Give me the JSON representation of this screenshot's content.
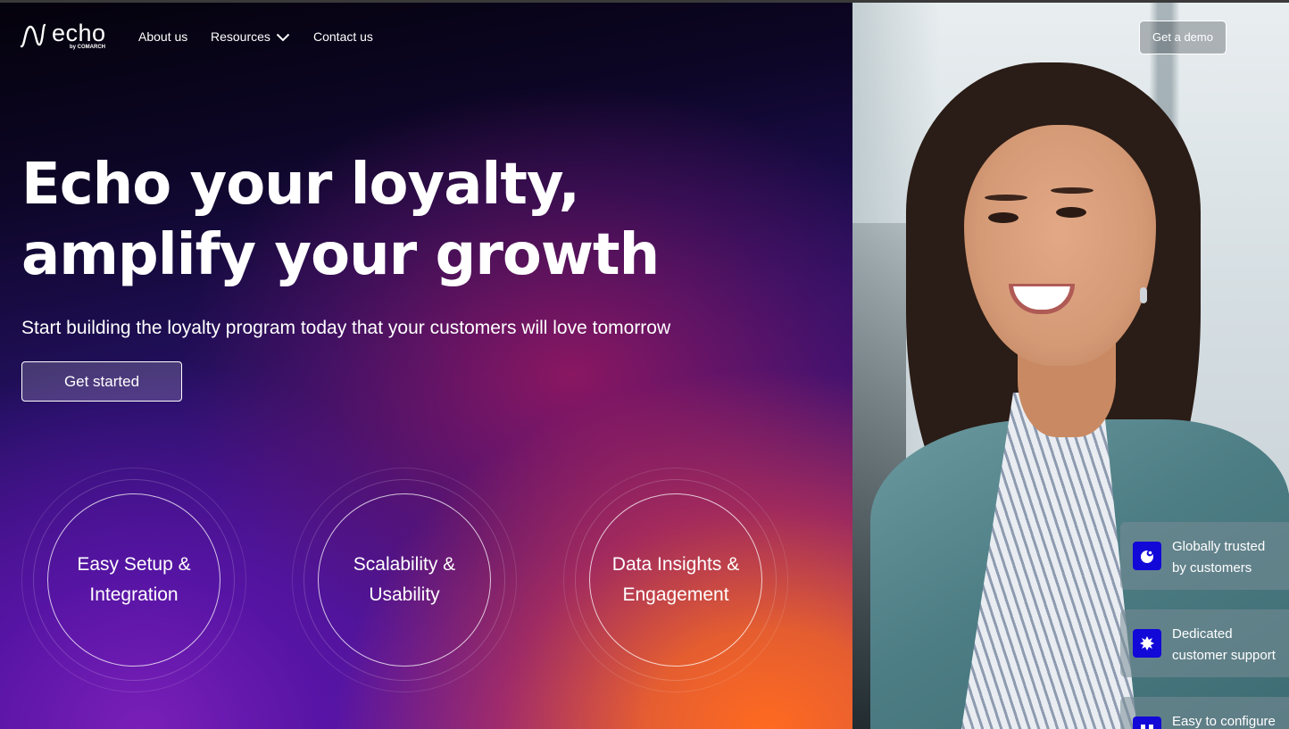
{
  "brand": {
    "name": "echo",
    "tagline": "by COMARCH"
  },
  "nav": {
    "about": "About us",
    "resources": "Resources",
    "contact": "Contact us",
    "demo": "Get a demo"
  },
  "hero": {
    "headline_line1": "Echo your loyalty,",
    "headline_line2": "amplify your growth",
    "subheadline": "Start building the loyalty program today that your customers will love tomorrow",
    "cta": "Get started"
  },
  "features": [
    {
      "line1": "Easy Setup &",
      "line2": "Integration"
    },
    {
      "line1": "Scalability &",
      "line2": "Usability"
    },
    {
      "line1": "Data Insights &",
      "line2": "Engagement"
    }
  ],
  "cards": [
    {
      "line1": "Globally trusted",
      "line2": "by customers",
      "icon": "globe-icon"
    },
    {
      "line1": "Dedicated",
      "line2": "customer support",
      "icon": "support-icon"
    },
    {
      "line1": "Easy to configure",
      "line2": "",
      "icon": "configure-icon"
    }
  ],
  "colors": {
    "accent_orange": "#ff6a1f",
    "accent_purple": "#5a1aa0",
    "card_icon_blue": "#1208d8"
  }
}
